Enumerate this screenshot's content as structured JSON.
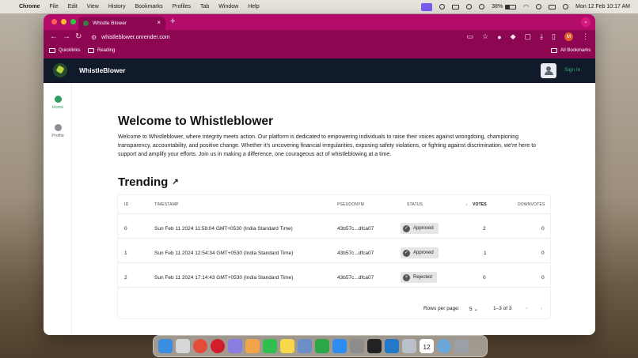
{
  "menubar": {
    "app": "Chrome",
    "items": [
      "File",
      "Edit",
      "View",
      "History",
      "Bookmarks",
      "Profiles",
      "Tab",
      "Window",
      "Help"
    ],
    "battery": "38%",
    "battery_level": 0.38,
    "datetime": "Mon 12 Feb  10:17 AM"
  },
  "browser": {
    "tab_title": "Whistle Blower",
    "url": "whistleblower.onrender.com",
    "profile_initial": "M",
    "bookmarks": [
      "Quicklinks",
      "Reading"
    ],
    "all_bookmarks": "All Bookmarks"
  },
  "header": {
    "title": "WhistleBlower",
    "signin": "Sign In"
  },
  "sidebar": {
    "items": [
      {
        "label": "Home",
        "icon": "home-icon"
      },
      {
        "label": "Profile",
        "icon": "profile-icon"
      }
    ]
  },
  "main": {
    "heading": "Welcome to Whistleblower",
    "intro": "Welcome to Whistleblower, where integrity meets action. Our platform is dedicated to empowering individuals to raise their voices against wrongdoing, championing transparency, accountability, and positive change. Whether it's uncovering financial irregularities, exposing safety violations, or fighting against discrimination, we're here to support and amplify your efforts. Join us in making a difference, one courageous act of whistleblowing at a time.",
    "trending_heading": "Trending"
  },
  "table": {
    "columns": {
      "id": "ID",
      "timestamp": "TIMESTAMP",
      "pseudonym": "PSEUDONYM",
      "status": "STATUS",
      "votes": "VOTES",
      "downvotes": "DOWNVOTES"
    },
    "rows": [
      {
        "id": "0",
        "timestamp": "Sun Feb 11 2024 11:58:04 GMT+0530 (India Standard Time)",
        "pseudonym": "43b57c...dfca07",
        "status": "Approved",
        "votes": "2",
        "downvotes": "0"
      },
      {
        "id": "1",
        "timestamp": "Sun Feb 11 2024 12:54:34 GMT+0530 (India Standard Time)",
        "pseudonym": "43b57c...dfca07",
        "status": "Approved",
        "votes": "1",
        "downvotes": "0"
      },
      {
        "id": "2",
        "timestamp": "Sun Feb 11 2024 17:14:43 GMT+0530 (India Standard Time)",
        "pseudonym": "43b57c...dfca07",
        "status": "Rejected",
        "votes": "0",
        "downvotes": "0"
      }
    ],
    "pagination": {
      "rows_per_page_label": "Rows per page:",
      "rows_per_page": "5",
      "range": "1–3 of 3"
    }
  },
  "dock": {
    "date_badge": "12"
  },
  "colors": {
    "browser_accent": "#8c0652",
    "header_bg": "#101a2b",
    "brand_green": "#2f9e5f"
  }
}
